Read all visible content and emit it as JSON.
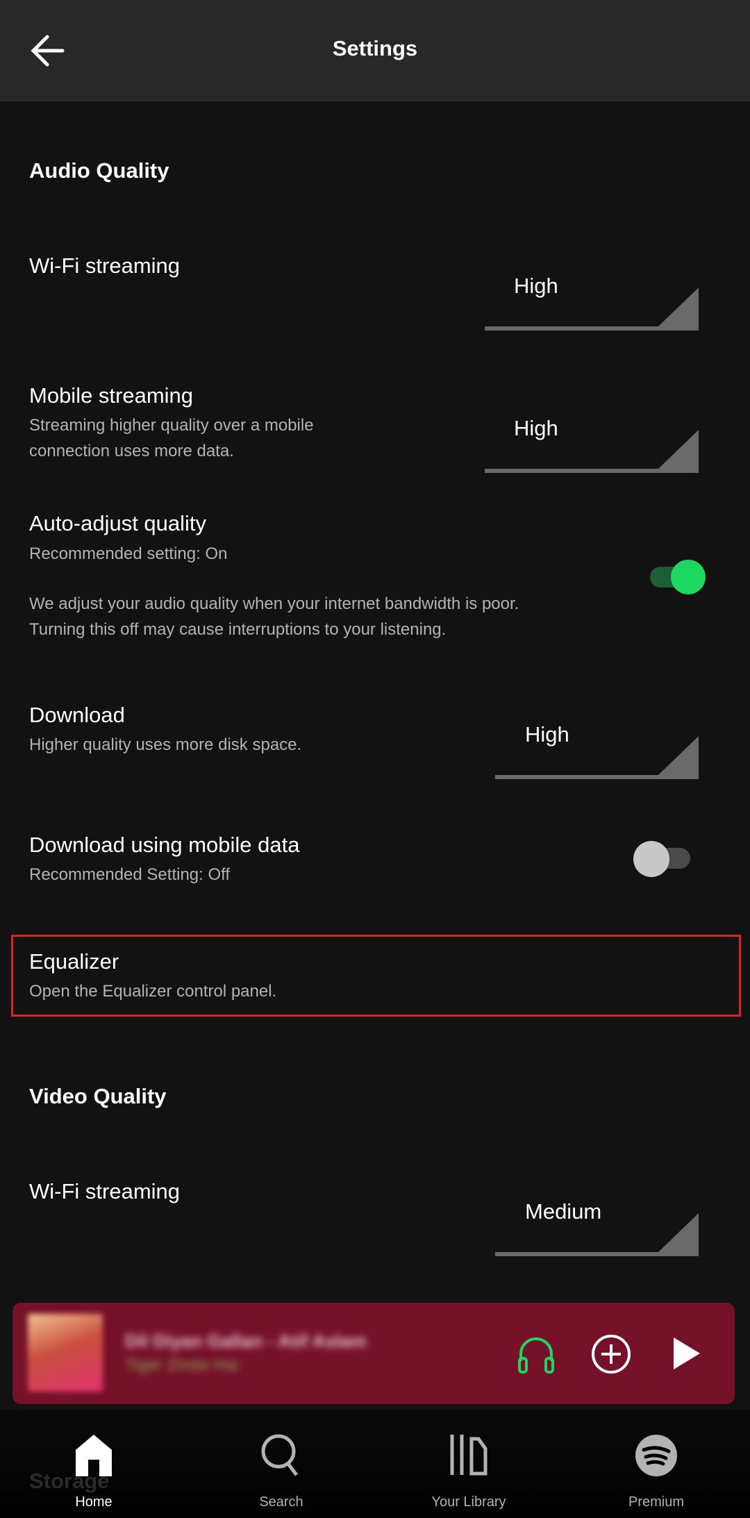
{
  "header": {
    "title": "Settings",
    "back_icon": "arrow-left-icon"
  },
  "audio_quality": {
    "heading": "Audio Quality",
    "wifi": {
      "title": "Wi-Fi streaming",
      "value": "High"
    },
    "mobile": {
      "title": "Mobile streaming",
      "desc1": "Streaming higher quality over a mobile",
      "desc2": "connection uses more data.",
      "value": "High"
    },
    "auto_adjust": {
      "title": "Auto-adjust quality",
      "rec": "Recommended setting: On",
      "desc1": "We adjust your audio quality when your internet bandwidth is poor.",
      "desc2": "Turning this off may cause interruptions to your listening.",
      "enabled": true
    },
    "download": {
      "title": "Download",
      "desc": "Higher quality uses more disk space.",
      "value": "High"
    },
    "download_mobile": {
      "title": "Download using mobile data",
      "rec": "Recommended Setting: Off",
      "enabled": false
    },
    "equalizer": {
      "title": "Equalizer",
      "desc": "Open the Equalizer control panel."
    }
  },
  "video_quality": {
    "heading": "Video Quality",
    "wifi": {
      "title": "Wi-Fi streaming",
      "value": "Medium"
    }
  },
  "storage_heading": "Storage",
  "mini_player": {
    "background": "#76112a",
    "song": "Dil Diyan Gallan - Atif Aslam",
    "artist": "Tiger Zinda Hai",
    "icons": [
      "headphones-icon",
      "add-circle-icon",
      "play-icon"
    ]
  },
  "nav": {
    "items": [
      {
        "label": "Home",
        "icon": "home-icon",
        "active": true
      },
      {
        "label": "Search",
        "icon": "search-icon"
      },
      {
        "label": "Your Library",
        "icon": "library-icon"
      },
      {
        "label": "Premium",
        "icon": "spotify-icon"
      }
    ]
  },
  "colors": {
    "accent": "#1ed760",
    "highlight": "#e0202a",
    "background": "#121212"
  }
}
